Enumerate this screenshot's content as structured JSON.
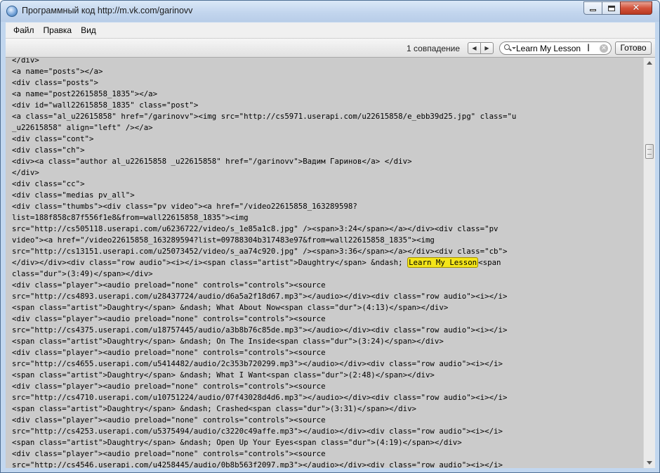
{
  "window": {
    "title": "Программный код http://m.vk.com/garinovv",
    "icon": "globe-icon"
  },
  "menu": {
    "items": [
      "Файл",
      "Правка",
      "Вид"
    ]
  },
  "find_bar": {
    "match_count": "1 совпадение",
    "prev_glyph": "◀",
    "next_glyph": "▶",
    "search_value": "Learn My Lesson",
    "done_label": "Готово"
  },
  "source": {
    "highlight_color": "#f3e51a",
    "highlight_text": "Learn My Lesson",
    "lines": [
      "</div>",
      "<a name=\"posts\"></a>",
      "<div class=\"posts\">",
      "<a name=\"post22615858_1835\"></a>",
      "<div id=\"wall22615858_1835\" class=\"post\">",
      "<a class=\"al_u22615858\" href=\"/garinovv\"><img src=\"http://cs5971.userapi.com/u22615858/e_ebb39d25.jpg\" class=\"u",
      "_u22615858\" align=\"left\" /></a>",
      "<div class=\"cont\">",
      "<div class=\"ch\">",
      "<div><a class=\"author al_u22615858 _u22615858\" href=\"/garinovv\">Вадим Гаринов</a> </div>",
      "</div>",
      "<div class=\"cc\">",
      "<div class=\"medias pv_all\">",
      "<div class=\"thumbs\"><div class=\"pv video\"><a href=\"/video22615858_163289598?",
      "list=188f858c87f556f1e8&from=wall22615858_1835\"><img",
      "src=\"http://cs505118.userapi.com/u6236722/video/s_1e85a1c8.jpg\" /><span>3:24</span></a></div><div class=\"pv",
      "video\"><a href=\"/video22615858_163289594?list=09788304b317483e97&from=wall22615858_1835\"><img",
      "src=\"http://cs13151.userapi.com/u25073452/video/s_aa74c920.jpg\" /><span>3:36</span></a></div><div class=\"cb\">",
      "</div></div><div class=\"row audio\"><i></i><span class=\"artist\">Daughtry</span> &ndash; Learn My Lesson<span",
      "class=\"dur\">(3:49)</span></div>",
      "<div class=\"player\"><audio preload=\"none\" controls=\"controls\"><source",
      "src=\"http://cs4893.userapi.com/u28437724/audio/d6a5a2f18d67.mp3\"></audio></div><div class=\"row audio\"><i></i>",
      "<span class=\"artist\">Daughtry</span> &ndash; What About Now<span class=\"dur\">(4:13)</span></div>",
      "<div class=\"player\"><audio preload=\"none\" controls=\"controls\"><source",
      "src=\"http://cs4375.userapi.com/u18757445/audio/a3b8b76c85de.mp3\"></audio></div><div class=\"row audio\"><i></i>",
      "<span class=\"artist\">Daughtry</span> &ndash; On The Inside<span class=\"dur\">(3:24)</span></div>",
      "<div class=\"player\"><audio preload=\"none\" controls=\"controls\"><source",
      "src=\"http://cs4655.userapi.com/u5414482/audio/2c353b720299.mp3\"></audio></div><div class=\"row audio\"><i></i>",
      "<span class=\"artist\">Daughtry</span> &ndash; What I Want<span class=\"dur\">(2:48)</span></div>",
      "<div class=\"player\"><audio preload=\"none\" controls=\"controls\"><source",
      "src=\"http://cs4710.userapi.com/u10751224/audio/07f43028d4d6.mp3\"></audio></div><div class=\"row audio\"><i></i>",
      "<span class=\"artist\">Daughtry</span> &ndash; Crashed<span class=\"dur\">(3:31)</span></div>",
      "<div class=\"player\"><audio preload=\"none\" controls=\"controls\"><source",
      "src=\"http://cs4253.userapi.com/u5375494/audio/c3220c49affe.mp3\"></audio></div><div class=\"row audio\"><i></i>",
      "<span class=\"artist\">Daughtry</span> &ndash; Open Up Your Eyes<span class=\"dur\">(4:19)</span></div>",
      "<div class=\"player\"><audio preload=\"none\" controls=\"controls\"><source",
      "src=\"http://cs4546.userapi.com/u4258445/audio/0b8b563f2097.mp3\"></audio></div><div class=\"row audio\"><i></i>"
    ]
  }
}
